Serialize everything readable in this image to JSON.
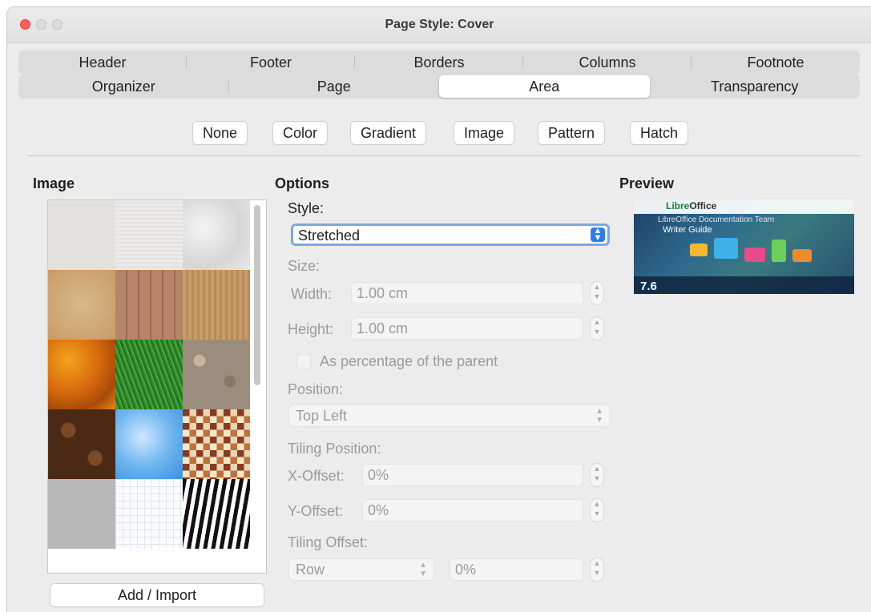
{
  "window": {
    "title": "Page Style: Cover"
  },
  "tabs": {
    "row1": [
      "Header",
      "Footer",
      "Borders",
      "Columns",
      "Footnote"
    ],
    "row2": [
      "Organizer",
      "Page",
      "Area",
      "Transparency"
    ],
    "active": "Area"
  },
  "fill_buttons": [
    "None",
    "Color",
    "Gradient",
    "Image",
    "Pattern",
    "Hatch"
  ],
  "image_section": {
    "title": "Image",
    "tiles": [
      "painted-white",
      "paper-white",
      "crumpled-paper",
      "parchment",
      "wooden-planks",
      "fine-wood",
      "autumn-leaves",
      "grass",
      "pebbles",
      "coffee-beans",
      "sky-clouds",
      "color-squares",
      "concrete",
      "graph-paper",
      "zebra-stripes"
    ],
    "add_button": "Add / Import"
  },
  "options": {
    "title": "Options",
    "style_label": "Style:",
    "style_value": "Stretched",
    "size_label": "Size:",
    "width_label": "Width:",
    "width_value": "1.00 cm",
    "height_label": "Height:",
    "height_value": "1.00 cm",
    "percentage_label": "As percentage of the parent",
    "position_label": "Position:",
    "position_value": "Top Left",
    "tiling_position_label": "Tiling Position:",
    "x_offset_label": "X-Offset:",
    "x_offset_value": "0%",
    "y_offset_label": "Y-Offset:",
    "y_offset_value": "0%",
    "tiling_offset_label": "Tiling Offset:",
    "tiling_offset_mode": "Row",
    "tiling_offset_value": "0%"
  },
  "preview": {
    "title": "Preview",
    "logo_green": "Libre",
    "logo_dark": "Office",
    "subtitle": "LibreOffice Documentation Team",
    "book_title": "Writer Guide",
    "version": "7.6"
  },
  "colors": {
    "accent": "#2c7cf6",
    "close_button": "#ff5f57"
  }
}
